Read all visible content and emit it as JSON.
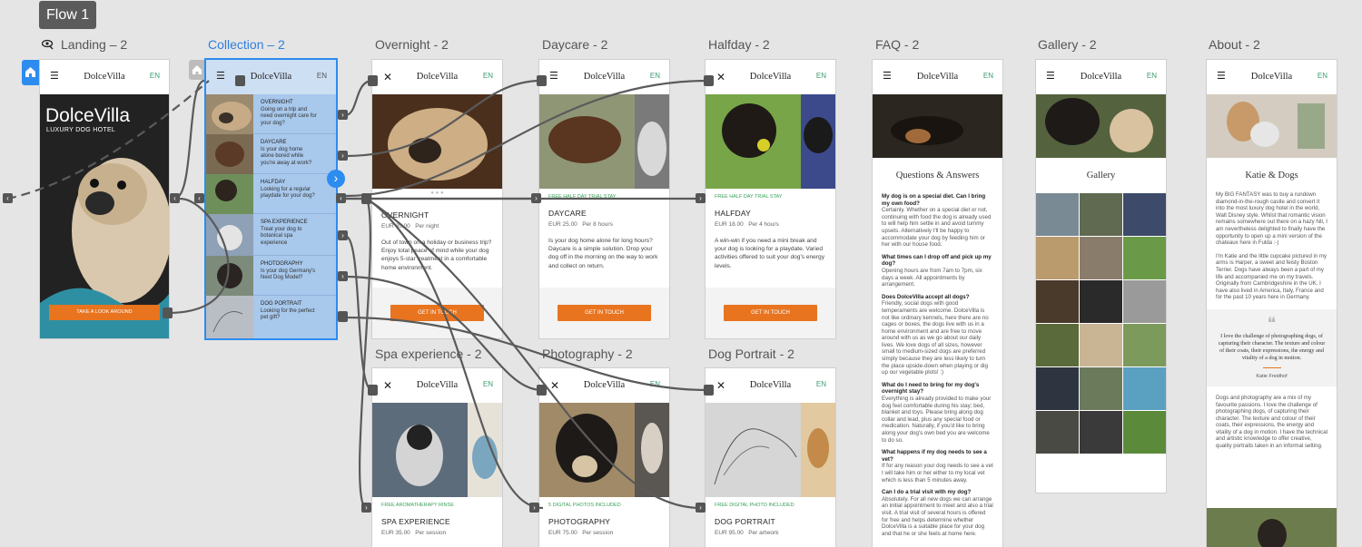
{
  "flow": {
    "badge": "Flow 1"
  },
  "frames": {
    "landing": "Landing – 2",
    "collection": "Collection – 2",
    "overnight": "Overnight - 2",
    "daycare": "Daycare - 2",
    "halfday": "Halfday - 2",
    "faq": "FAQ - 2",
    "gallery": "Gallery - 2",
    "about": "About - 2",
    "spa": "Spa experience - 2",
    "photography": "Photography - 2",
    "portrait": "Dog Portrait - 2"
  },
  "brand": {
    "logo": "DolceVilla",
    "lang": "EN"
  },
  "landing": {
    "hero_title": "DolceVilla",
    "hero_sub": "LUXURY DOG HOTEL",
    "cta": "TAKE A LOOK AROUND"
  },
  "collection": {
    "items": [
      {
        "title": "OVERNIGHT",
        "desc": "Going on a trip and need overnight care for your dog?"
      },
      {
        "title": "DAYCARE",
        "desc": "Is your dog home alone bored while you're away at work?"
      },
      {
        "title": "HALFDAY",
        "desc": "Looking for a regular playdate for your dog?"
      },
      {
        "title": "SPA EXPERIENCE",
        "desc": "Treat your dog to botanical spa experience"
      },
      {
        "title": "PHOTOGRAPHY",
        "desc": "Is your dog Germany's Next Dog Model?"
      },
      {
        "title": "DOG PORTRAIT",
        "desc": "Looking for the perfect pet gift?"
      }
    ]
  },
  "overnight": {
    "title": "OVERNIGHT",
    "price": "EUR 35.00",
    "unit": "Per night",
    "desc": "Out of town on a holiday or business trip? Enjoy total peace of mind while your dog enjoys 5-star treatment in a comfortable home environment.",
    "cta": "GET IN TOUCH"
  },
  "daycare": {
    "mini": "FREE HALF DAY TRIAL STAY",
    "title": "DAYCARE",
    "price": "EUR 25.00",
    "unit": "Per 8 hours",
    "desc": "Is your dog home alone for long hours? Daycare is a simple solution. Drop your dog off in the morning on the way to work and collect on return.",
    "cta": "GET IN TOUCH"
  },
  "halfday": {
    "mini": "FREE HALF DAY TRIAL STAY",
    "title": "HALFDAY",
    "price": "EUR 18.00",
    "unit": "Per 4 hours",
    "desc": "A win-win if you need a mini break and your dog is looking for a playdate. Varied activities offered to suit your dog's energy levels.",
    "cta": "GET IN TOUCH"
  },
  "spa": {
    "mini": "FREE AROMATHERAPY RINSE",
    "title": "SPA EXPERIENCE",
    "price": "EUR 35.00",
    "unit": "Per session"
  },
  "photography": {
    "mini": "5 DIGITAL PHOTOS INCLUDED",
    "title": "PHOTOGRAPHY",
    "price": "EUR 75.00",
    "unit": "Per session"
  },
  "portrait": {
    "mini": "FREE DIGITAL PHOTO INCLUDED",
    "title": "DOG PORTRAIT",
    "price": "EUR 95.00",
    "unit": "Per artwork"
  },
  "faq": {
    "heading": "Questions & Answers",
    "items": [
      {
        "q": "My dog is on a special diet. Can I bring my own food?",
        "a": "Certainly. Whether on a special diet or not, continuing with food the dog is already used to will help him settle in and avoid tummy upsets. Alternatively I'll be happy to accommodate your dog by feeding him or her with our house food."
      },
      {
        "q": "What times can I drop off and pick up my dog?",
        "a": "Opening hours are from 7am to 7pm, six days a week. All appointments by arrangement."
      },
      {
        "q": "Does DolceVilla accept all dogs?",
        "a": "Friendly, social dogs with good temperaments are welcome. DolceVilla is not like ordinary kennels, here there are no cages or boxes, the dogs live with us in a home environment and are free to move around with us as we go about our daily lives. We love dogs of all sizes, however small to medium-sized dogs are preferred simply because they are less likely to turn the place upside-down when playing or dig up our vegetable plots! :)"
      },
      {
        "q": "What do I need to bring for my dog's overnight stay?",
        "a": "Everything is already provided to make your dog feel comfortable during his stay; bed, blanket and toys. Please bring along dog collar and lead, plus any special food or medication. Naturally, if you'd like to bring along your dog's own bed you are welcome to do so."
      },
      {
        "q": "What happens if my dog needs to see a vet?",
        "a": "If for any reason your dog needs to see a vet I will take him or her either to my local vet which is less than 5 minutes away."
      },
      {
        "q": "Can I do a trial visit with my dog?",
        "a": "Absolutely. For all new dogs we can arrange an initial appointment to meet and also a trial visit. A trial visit of several hours is offered for free and helps determine whether DolceVilla is a suitable place for your dog and that he or she feels at home here."
      }
    ]
  },
  "gallery": {
    "heading": "Gallery"
  },
  "about": {
    "heading": "Katie & Dogs",
    "p1": "My BIG FANTASY was to buy a rundown diamond-in-the-rough castle and convert it into the most luxury dog hotel in the world, Walt Disney style. Whilst that romantic vision remains somewhere out there on a hazy hill, I am nevertheless delighted to finally have the opportunity to open up a mini version of the chateaux here in Fulda :-)",
    "p2": "I'm Katie and the little cupcake pictured in my arms is Harper, a sweet and feisty Boston Terrier. Dogs have always been a part of my life and accompanied me on my travels. Originally from Cambridgeshire in the UK. I have also lived in America, Italy, France and for the past 10 years here in Germany.",
    "quote": "I love the challenge of photographing dogs, of capturing their character. The texture and colour of their coats, their expressions, the energy and vitality of a dog in motion.",
    "quote_author": "Katie Freidhof",
    "p3": "Dogs and photography are a mix of my favourite passions. I love the challenge of photographing dogs, of capturing their character. The texture and colour of their coats, their expressions, the energy and vitality of a dog in motion. I have the technical and artistic knowledge to offer creative, quality portraits taken in an informal setting."
  },
  "colors": {
    "accent": "#e8741f",
    "selection": "#2d8cf0",
    "flow_badge": "#5b5b5b",
    "wire": "#5a5a5a"
  }
}
